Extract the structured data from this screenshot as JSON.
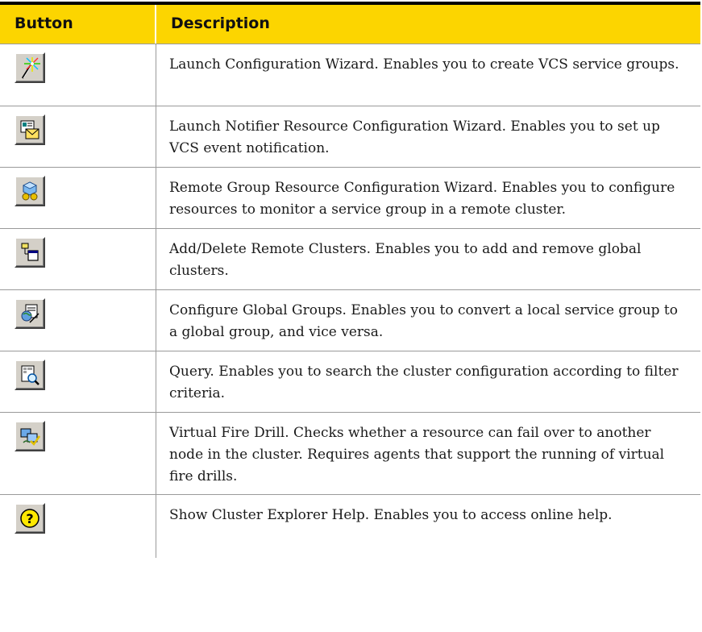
{
  "table": {
    "headers": {
      "button": "Button",
      "description": "Description"
    },
    "rows": [
      {
        "icon": "magic-wand-icon",
        "description": "Launch Configuration Wizard. Enables you to create VCS service groups."
      },
      {
        "icon": "notifier-envelope-icon",
        "description": "Launch Notifier Resource Configuration Wizard. Enables you to set up VCS event notification."
      },
      {
        "icon": "remote-group-resource-icon",
        "description": "Remote Group Resource Configuration Wizard. Enables you to configure resources to monitor a service group in a remote cluster."
      },
      {
        "icon": "remote-clusters-icon",
        "description": "Add/Delete Remote Clusters. Enables you to add and remove global clusters."
      },
      {
        "icon": "global-groups-icon",
        "description": "Configure Global Groups. Enables you to convert a local service group to a global group, and vice versa."
      },
      {
        "icon": "query-magnifier-icon",
        "description": "Query. Enables you to search the cluster configuration according to filter criteria."
      },
      {
        "icon": "virtual-fire-drill-icon",
        "description": "Virtual Fire Drill. Checks whether a resource can fail over to another node in the cluster. Requires agents that support the running of virtual fire drills."
      },
      {
        "icon": "help-question-icon",
        "description": "Show Cluster Explorer Help. Enables you to access online help."
      }
    ]
  },
  "colors": {
    "header_bg": "#fcd500",
    "rule": "#9a9a9a",
    "button_face": "#d4d0c8"
  }
}
